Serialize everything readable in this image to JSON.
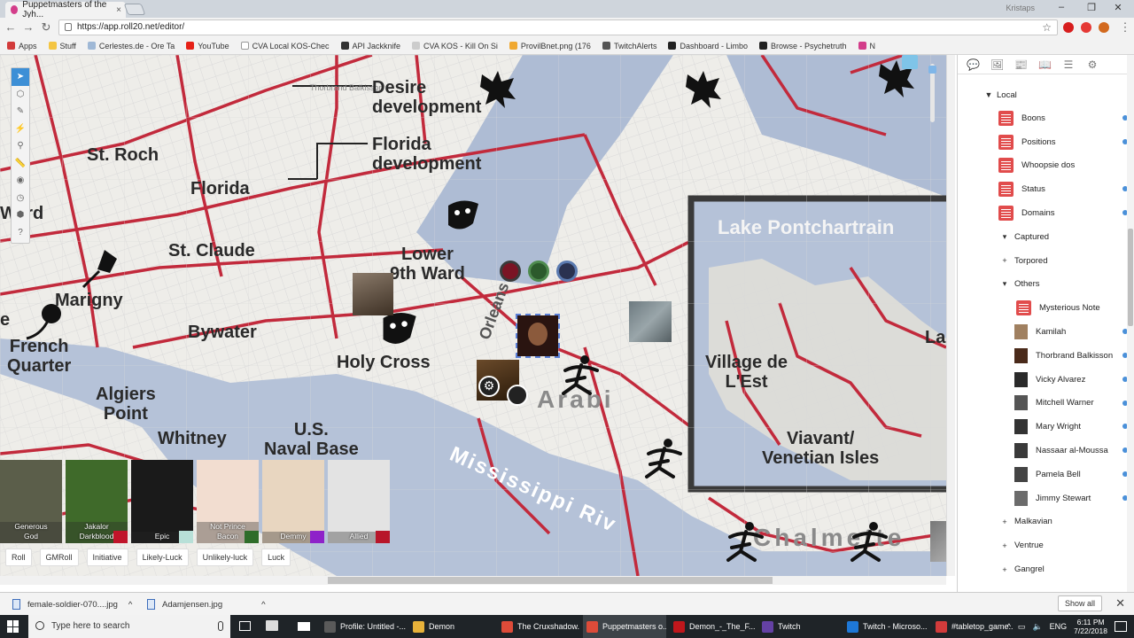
{
  "browser": {
    "tab_title": "Puppetmasters of the Jyh...",
    "tab_close": "×",
    "window_user": "Kristaps",
    "window_controls": {
      "minimize": "–",
      "restore": "❐",
      "close": "✕"
    },
    "nav": {
      "back": "←",
      "forward": "→",
      "reload": "↻"
    },
    "url": "https://app.roll20.net/editor/",
    "bookmarks": [
      {
        "label": "Apps",
        "color": "#d23b3b"
      },
      {
        "label": "Stuff",
        "color": "#f4c542"
      },
      {
        "label": "Cerlestes.de - Ore Ta",
        "color": "#9fb8d6"
      },
      {
        "label": "YouTube",
        "color": "#e62117"
      },
      {
        "label": "CVA Local KOS-Chec",
        "color": "#ffffff"
      },
      {
        "label": "API Jackknife",
        "color": "#333333"
      },
      {
        "label": "CVA KOS - Kill On Si",
        "color": "#cccccc"
      },
      {
        "label": "ProvilBnet.png (176",
        "color": "#f0a830"
      },
      {
        "label": "TwitchAlerts",
        "color": "#555555"
      },
      {
        "label": "Dashboard - Limbo",
        "color": "#222222"
      },
      {
        "label": "Browse - Psychetruth",
        "color": "#222222"
      },
      {
        "label": "N",
        "color": "#d33d8a"
      }
    ]
  },
  "map": {
    "labels": {
      "desire": "Desire\ndevelopment",
      "florida_dev": "Florida\ndevelopment",
      "st_roch": "St. Roch",
      "florida": "Florida",
      "ward": "Ward",
      "st_claude": "St. Claude",
      "lower_ward": "Lower\n9th Ward",
      "marigny": "Marigny",
      "french_quarter": "French\nQuarter",
      "e": "e",
      "bywater": "Bywater",
      "holy_cross": "Holy Cross",
      "algiers_point": "Algiers\nPoint",
      "whitney": "Whitney",
      "naval_base": "U.S.\nNaval Base",
      "orleans": "Orleans",
      "arabi": "Arabi",
      "lake": "Lake Pontchartrain",
      "village": "Village de\nL'Est",
      "viavant": "Viavant/\nVenetian Isles",
      "la": "La",
      "mississippi": "Mississippi Riv",
      "chalmette": "Chalmette",
      "thorbrand_tag": "Thorbrand Balkisson"
    }
  },
  "toolbar": {
    "tools": [
      {
        "icon": "select-icon",
        "glyph": "➤",
        "active": true
      },
      {
        "icon": "layers-icon",
        "glyph": "⬡",
        "active": false
      },
      {
        "icon": "draw-icon",
        "glyph": "✎",
        "active": false
      },
      {
        "icon": "fx-icon",
        "glyph": "⚡",
        "active": false
      },
      {
        "icon": "zoom-icon",
        "glyph": "⚲",
        "active": false
      },
      {
        "icon": "ruler-icon",
        "glyph": "📏",
        "active": false
      },
      {
        "icon": "fog-icon",
        "glyph": "◉",
        "active": false
      },
      {
        "icon": "turn-tracker-icon",
        "glyph": "◷",
        "active": false
      },
      {
        "icon": "dice-icon",
        "glyph": "⬢",
        "active": false
      },
      {
        "icon": "help-icon",
        "glyph": "?",
        "active": false
      }
    ]
  },
  "macros": [
    {
      "label": "Generous\nGod",
      "swatch": "",
      "bg": "#5b5e4a"
    },
    {
      "label": "Jakalor\nDarkblood",
      "swatch": "#c0152a",
      "bg": "#3f6a2a"
    },
    {
      "label": "Epic",
      "swatch": "#b8e0d8",
      "bg": "#1a1a1a"
    },
    {
      "label": "Not Prince\nBacon",
      "swatch": "#2f6d2a",
      "bg": "#f2ddd0"
    },
    {
      "label": "Demmy",
      "swatch": "#8e22c9",
      "bg": "#e8d6c0"
    },
    {
      "label": "Allied",
      "swatch": "#b8162a",
      "bg": "#e3e3e3"
    }
  ],
  "quick_buttons": [
    "Roll",
    "GMRoll",
    "Initiative",
    "Likely-Luck",
    "Unlikely-luck",
    "Luck"
  ],
  "sidebar": {
    "tabs": [
      "chat-icon",
      "art-icon",
      "journal-icon",
      "compendium-icon",
      "jukebox-icon",
      "settings-icon"
    ],
    "tab_glyphs": [
      "💬",
      "🖼",
      "📰",
      "📖",
      "☰",
      "⚙"
    ],
    "root": "Local",
    "items": [
      {
        "label": "Boons",
        "type": "handout",
        "indent": 1,
        "dot": true
      },
      {
        "label": "Positions",
        "type": "handout",
        "indent": 1,
        "dot": true
      },
      {
        "label": "Whoopsie dos",
        "type": "handout",
        "indent": 1,
        "dot": false
      },
      {
        "label": "Status",
        "type": "handout",
        "indent": 1,
        "dot": true
      },
      {
        "label": "Domains",
        "type": "handout",
        "indent": 1,
        "dot": true
      },
      {
        "label": "Captured",
        "type": "folder-open",
        "indent": 1,
        "dot": false
      },
      {
        "label": "Torpored",
        "type": "folder-closed",
        "indent": 1,
        "dot": false
      },
      {
        "label": "Others",
        "type": "folder-open",
        "indent": 1,
        "dot": false
      },
      {
        "label": "Mysterious Note",
        "type": "handout",
        "indent": 2,
        "dot": false
      },
      {
        "label": "Kamilah",
        "type": "character",
        "indent": 2,
        "dot": true,
        "color": "#a08060"
      },
      {
        "label": "Thorbrand Balkisson",
        "type": "character",
        "indent": 2,
        "dot": true,
        "color": "#4a2a1a"
      },
      {
        "label": "Vicky Alvarez",
        "type": "character",
        "indent": 2,
        "dot": true,
        "color": "#2a2a2a"
      },
      {
        "label": "Mitchell Warner",
        "type": "character",
        "indent": 2,
        "dot": true,
        "color": "#555555"
      },
      {
        "label": "Mary Wright",
        "type": "character",
        "indent": 2,
        "dot": true,
        "color": "#333333"
      },
      {
        "label": "Nassaar al-Moussa",
        "type": "character",
        "indent": 2,
        "dot": true,
        "color": "#3a3a3a"
      },
      {
        "label": "Pamela Bell",
        "type": "character",
        "indent": 2,
        "dot": true,
        "color": "#444444"
      },
      {
        "label": "Jimmy Stewart",
        "type": "character",
        "indent": 2,
        "dot": true,
        "color": "#6b6b6b"
      },
      {
        "label": "Malkavian",
        "type": "folder-closed",
        "indent": 1,
        "dot": false
      },
      {
        "label": "Ventrue",
        "type": "folder-closed",
        "indent": 1,
        "dot": false
      },
      {
        "label": "Gangrel",
        "type": "folder-closed",
        "indent": 1,
        "dot": false
      }
    ]
  },
  "downloads": {
    "items": [
      "female-soldier-070....jpg",
      "Adamjensen.jpg"
    ],
    "expand": "^",
    "show_all": "Show all",
    "close": "✕"
  },
  "taskbar": {
    "search_placeholder": "Type here to search",
    "items": [
      {
        "label": "Profile: Untitled -...",
        "color": "#5a5a5a",
        "active": false
      },
      {
        "label": "Demon",
        "color": "#e8b23a",
        "active": false
      },
      {
        "label": "The Cruxshadow...",
        "color": "#dd4b39",
        "active": false
      },
      {
        "label": "Puppetmasters o...",
        "color": "#dd4b39",
        "active": true
      },
      {
        "label": "Demon_-_The_F...",
        "color": "#c0171c",
        "active": false
      },
      {
        "label": "Twitch",
        "color": "#6441a4",
        "active": false
      },
      {
        "label": "Twitch - Microso...",
        "color": "#1e78d7",
        "active": false
      },
      {
        "label": "#tabletop_game...",
        "color": "#d23b3b",
        "active": false
      }
    ],
    "lang": "ENG",
    "time": "6:11 PM",
    "date": "7/22/2018"
  }
}
